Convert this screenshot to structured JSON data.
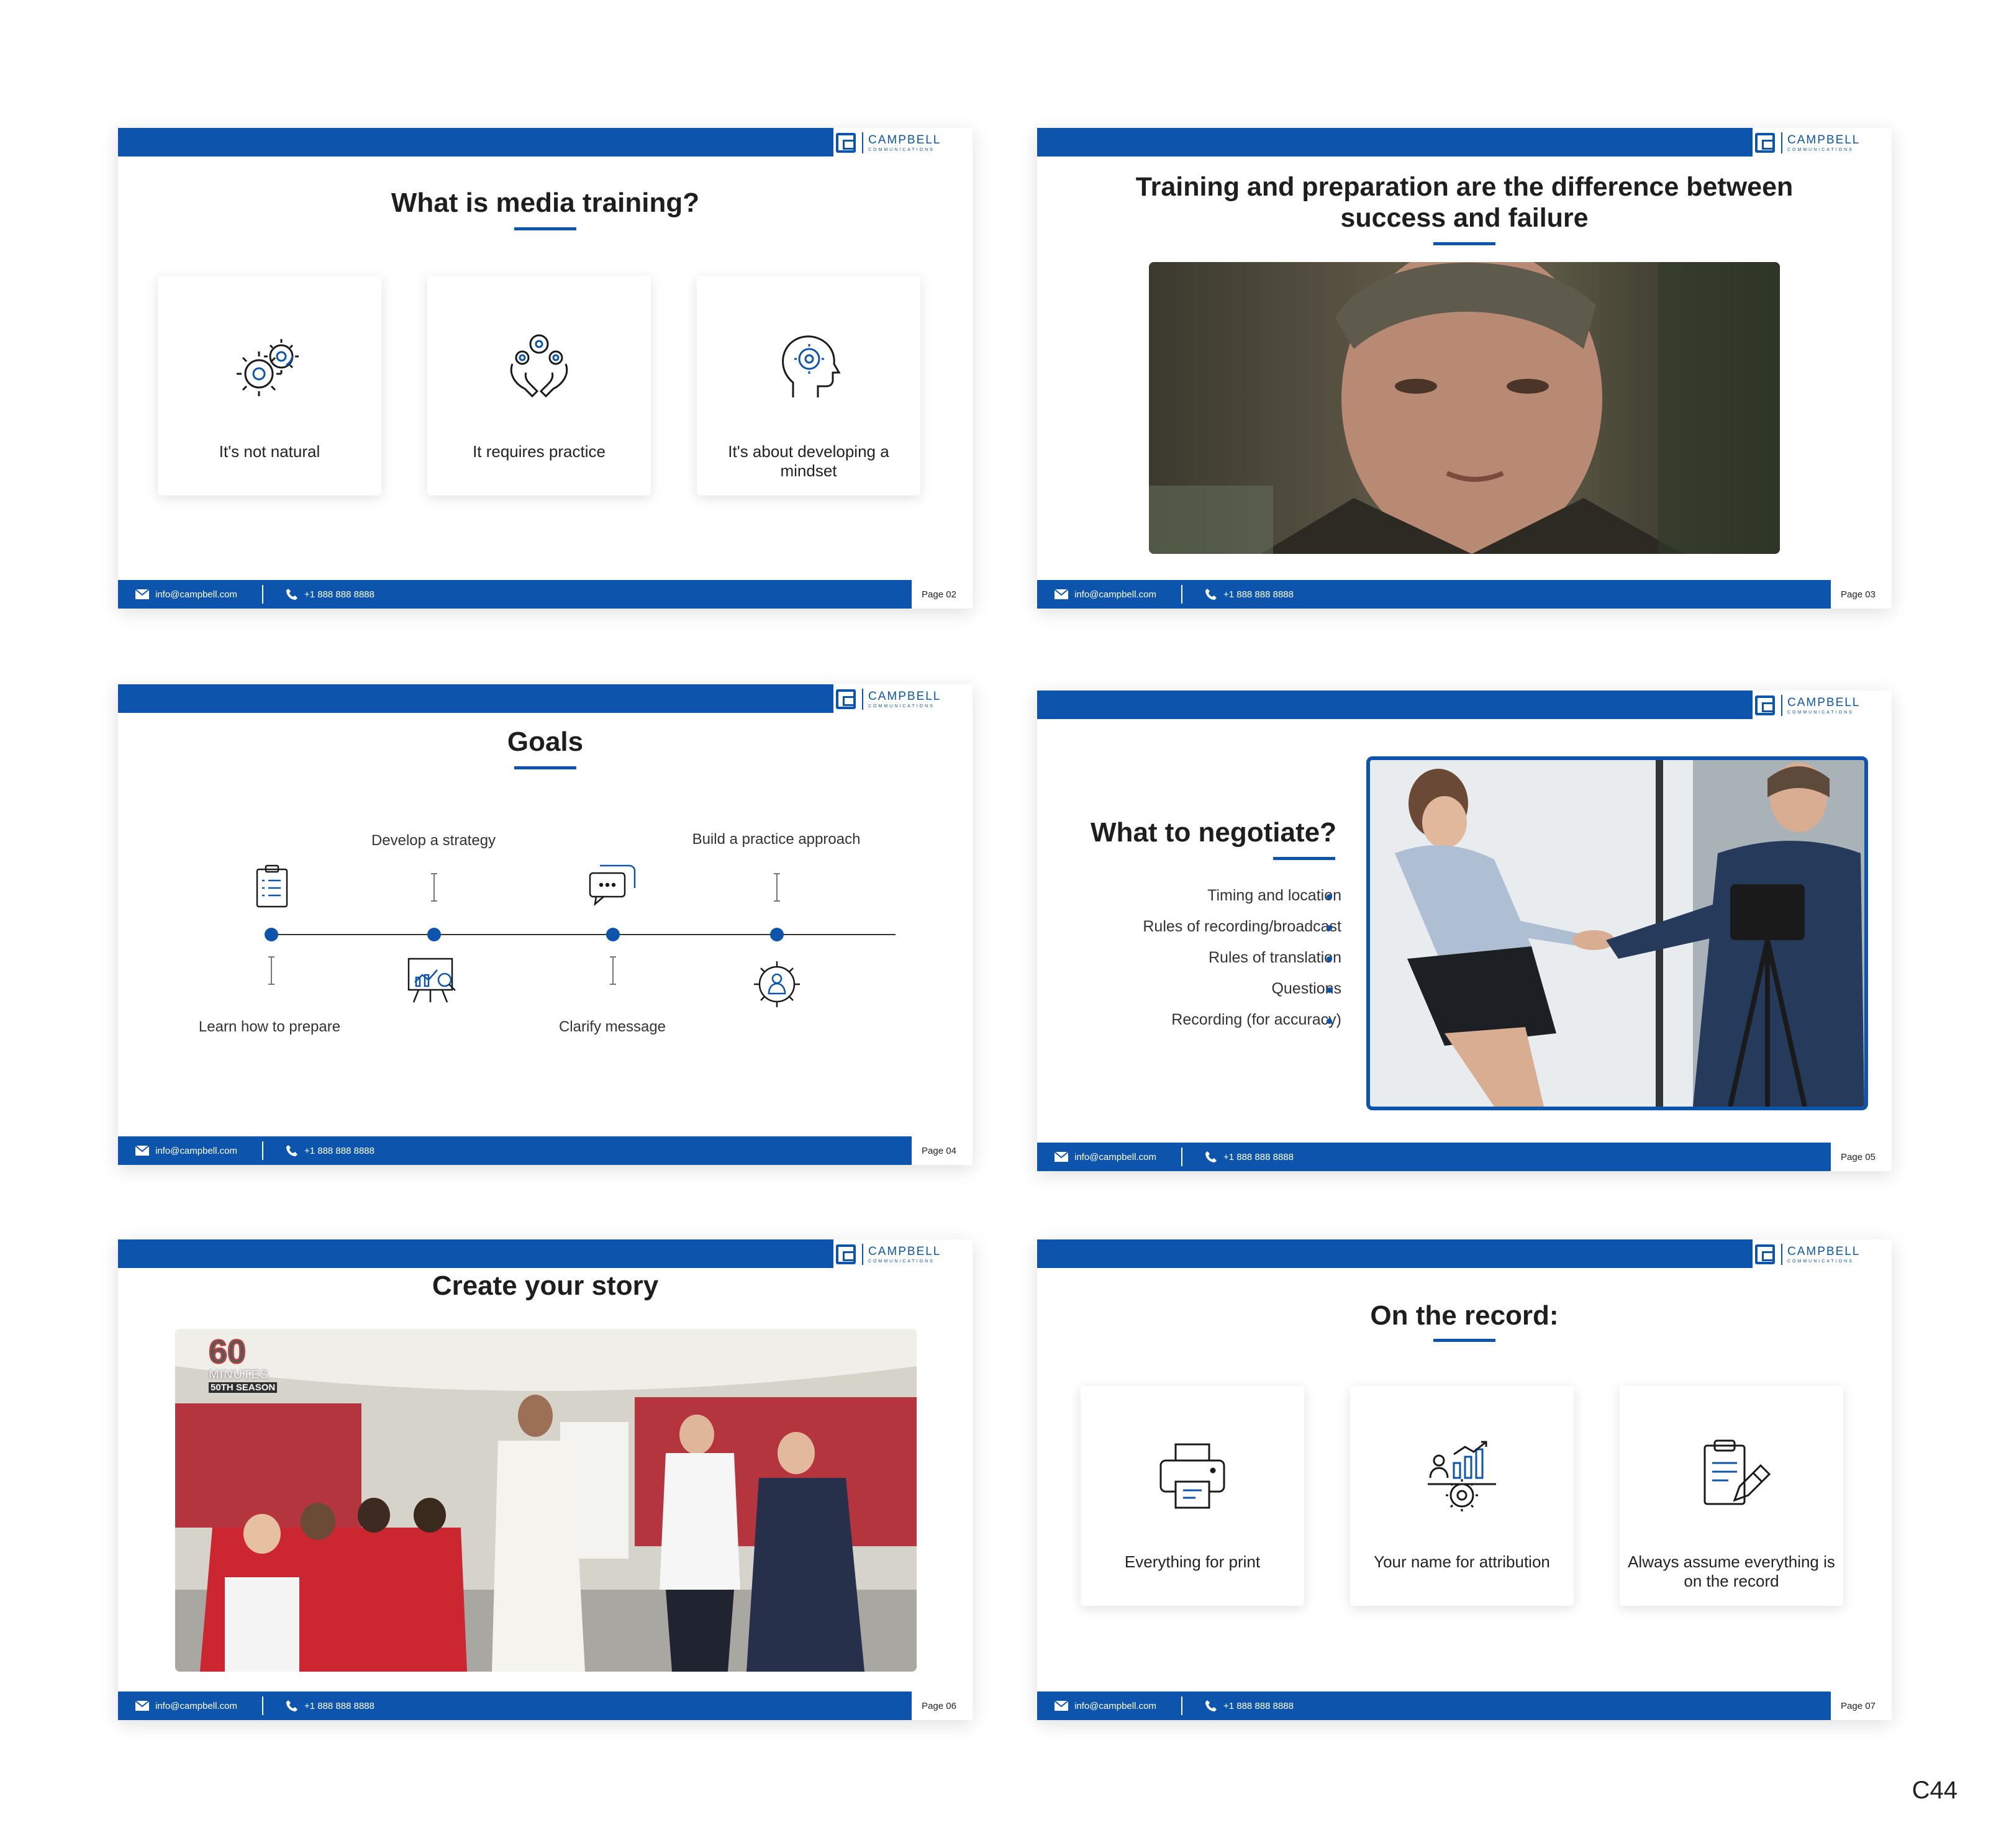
{
  "brand": {
    "name": "CAMPBELL",
    "sub": "COMMUNICATIONS",
    "color": "#0d55ac"
  },
  "footer": {
    "email": "info@campbell.com",
    "phone": "+1 888 888 8888"
  },
  "slide2": {
    "title": "What is media training?",
    "page": "Page 02",
    "cards": [
      {
        "label": "It's not natural",
        "icon": "gears-icon"
      },
      {
        "label": "It requires practice",
        "icon": "hands-gears-icon"
      },
      {
        "label": "It's about developing a mindset",
        "icon": "head-gear-icon"
      }
    ]
  },
  "slide3": {
    "title": "Training and preparation are the difference between success and failure",
    "page": "Page 03",
    "image": "interview-video-frame"
  },
  "slide4": {
    "title": "Goals",
    "page": "Page 04",
    "steps": [
      {
        "label": "Learn how to prepare",
        "icon": "clipboard-checklist-icon"
      },
      {
        "label": "Develop a strategy",
        "icon": "presentation-analysis-icon"
      },
      {
        "label": "Clarify message",
        "icon": "chat-bubbles-icon"
      },
      {
        "label": "Build a practice approach",
        "icon": "gear-person-icon"
      }
    ]
  },
  "slide5": {
    "title": "What to negotiate?",
    "page": "Page 05",
    "items": [
      "Timing and location",
      "Rules of recording/broadcast",
      "Rules of translation",
      "Questions",
      "Recording (for accuracy)"
    ],
    "image": "handshake-photo"
  },
  "slide6": {
    "title": "Create your story",
    "page": "Page 06",
    "badge": {
      "line1": "60",
      "line2": "MINUTES",
      "line3": "50TH SEASON"
    },
    "image": "school-visit-video-frame"
  },
  "slide7": {
    "title": "On the record:",
    "page": "Page 07",
    "cards": [
      {
        "label": "Everything for print",
        "icon": "printer-icon"
      },
      {
        "label": "Your name for attribution",
        "icon": "person-chart-icon"
      },
      {
        "label": "Always assume everything is on the record",
        "icon": "clipboard-pen-icon"
      }
    ]
  },
  "corner_code": "C44"
}
